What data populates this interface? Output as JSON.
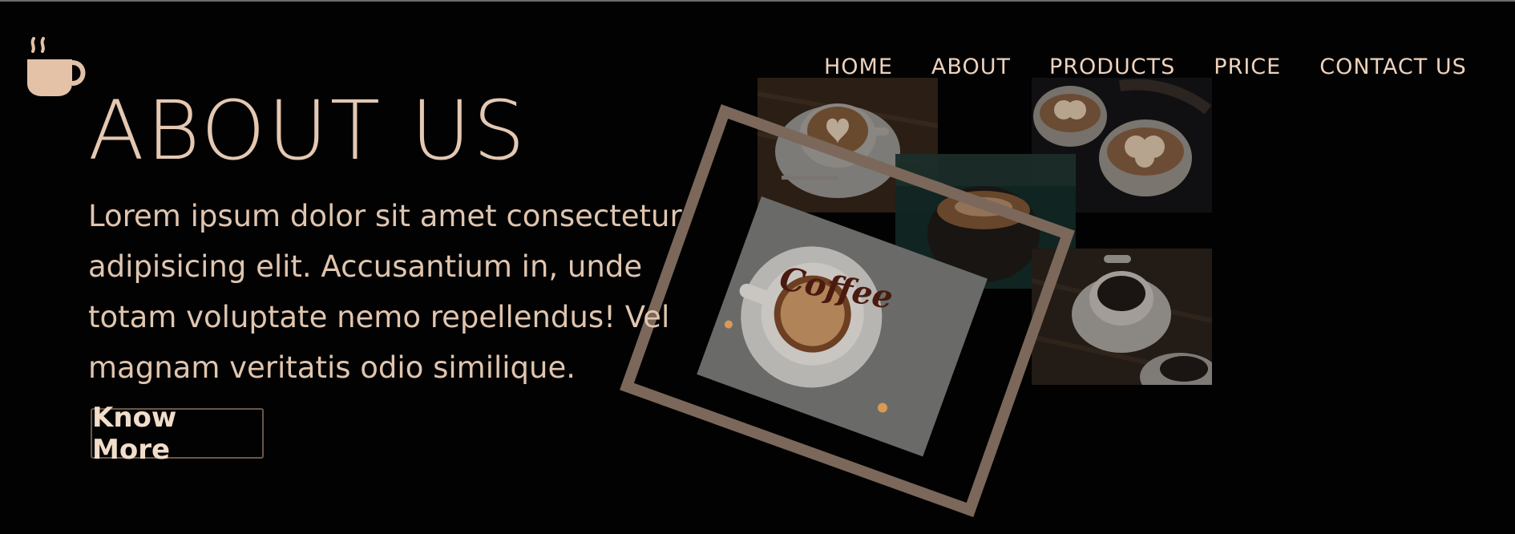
{
  "nav": {
    "items": [
      "HOME",
      "ABOUT",
      "PRODUCTS",
      "PRICE",
      "CONTACT US"
    ]
  },
  "hero": {
    "title": "ABOUT US",
    "description": "Lorem ipsum dolor sit amet consectetur adipisicing elit. Accusantium in, unde totam voluptate nemo repellendus! Vel magnam veritatis odio similique.",
    "button_label": "Know More",
    "featured_cup_text": "Coffee"
  },
  "icons": {
    "logo": "coffee-cup-icon"
  },
  "colors": {
    "background": "#020202",
    "text": "#e4c8b2",
    "frame": "#7b685a",
    "button_border": "#6b5648"
  }
}
